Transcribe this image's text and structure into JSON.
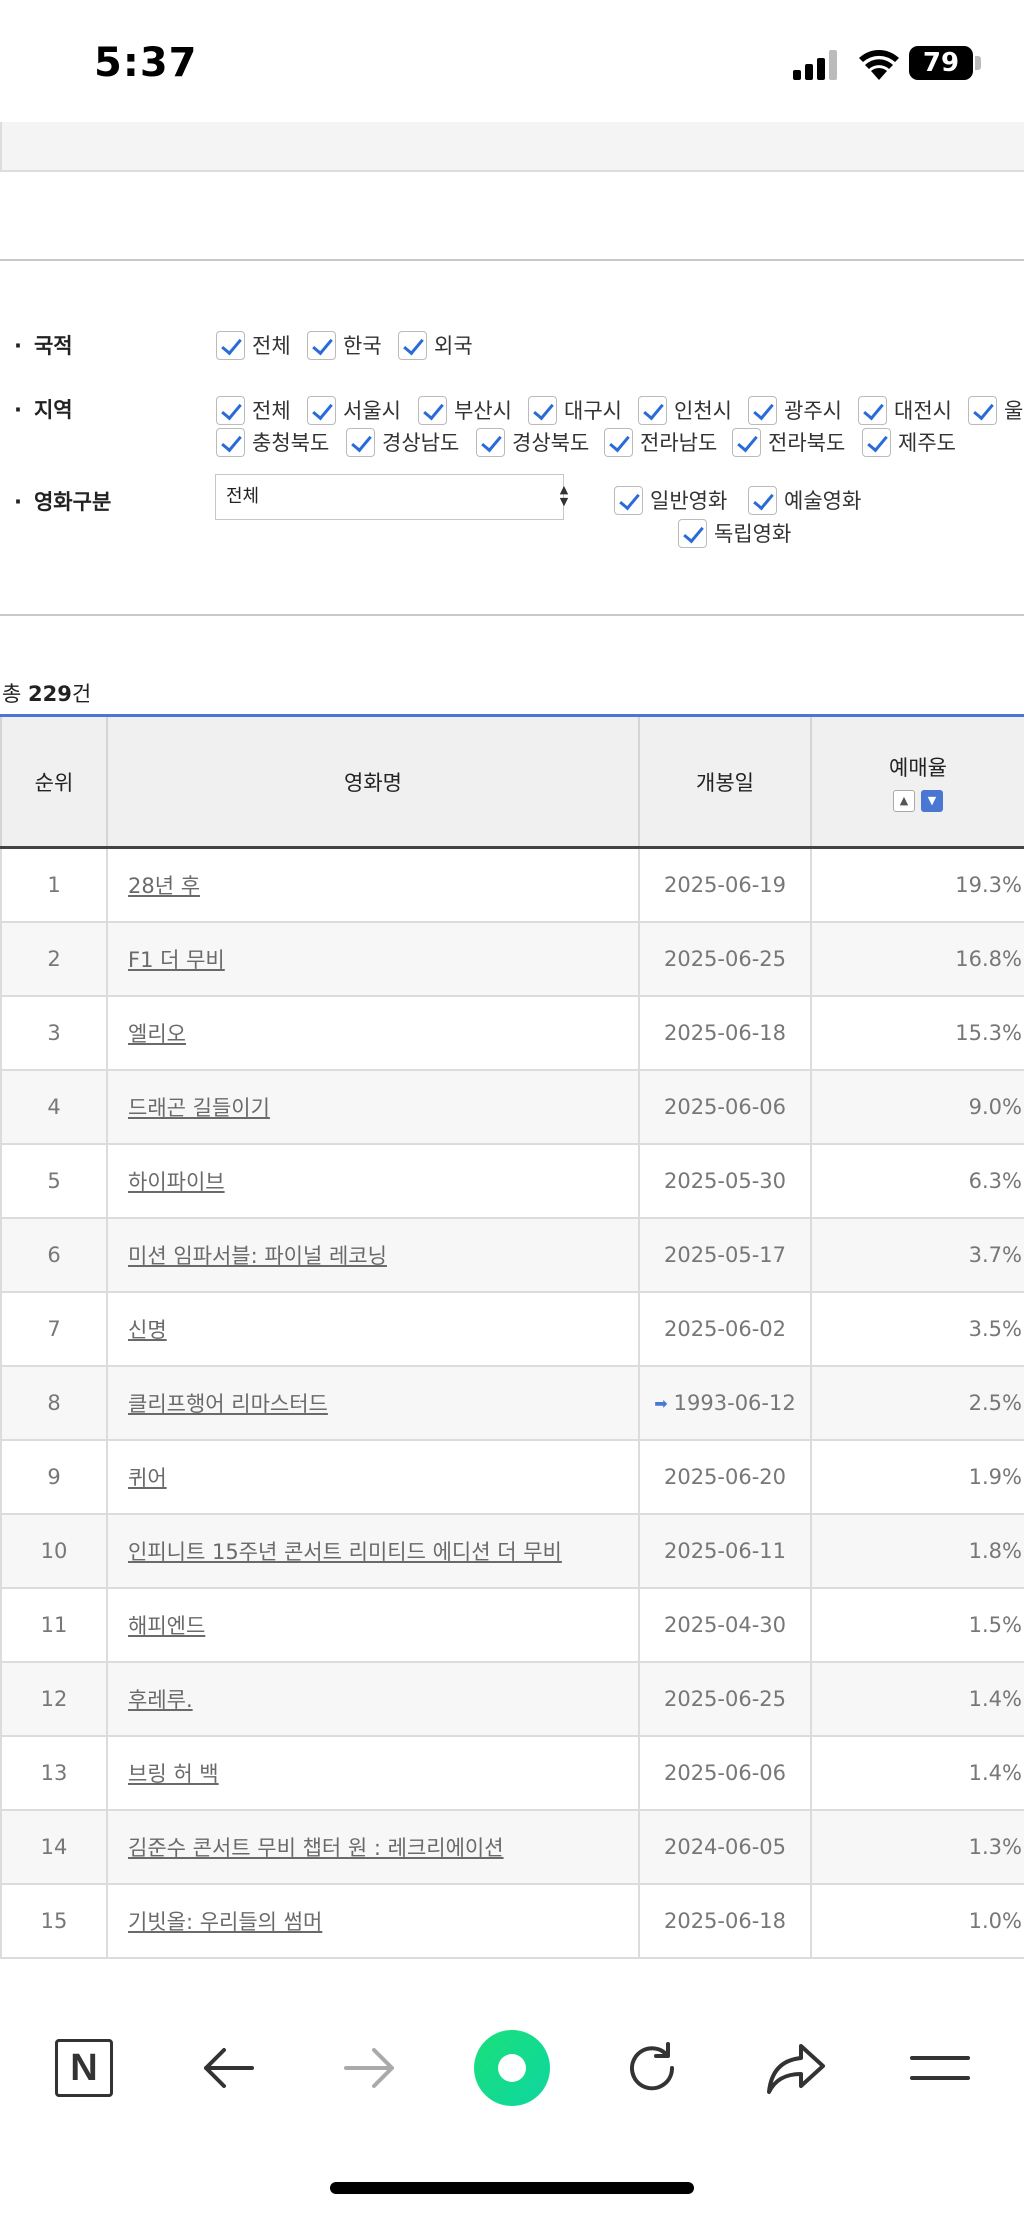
{
  "status": {
    "time": "5:37",
    "battery": "79"
  },
  "filters": {
    "nationality": {
      "label": "국적",
      "options": [
        "전체",
        "한국",
        "외국"
      ]
    },
    "region": {
      "label": "지역",
      "row1": [
        "전체",
        "서울시",
        "부산시",
        "대구시",
        "인천시",
        "광주시",
        "대전시",
        "울"
      ],
      "row2": [
        "충청북도",
        "경상남도",
        "경상북도",
        "전라남도",
        "전라북도",
        "제주도"
      ]
    },
    "movie_type": {
      "label": "영화구분",
      "select_value": "전체",
      "options": [
        "일반영화",
        "예술영화",
        "독립영화"
      ]
    }
  },
  "total": {
    "prefix": "총 ",
    "count": "229",
    "suffix": "건"
  },
  "table": {
    "headers": {
      "rank": "순위",
      "title": "영화명",
      "date": "개봉일",
      "rate": "예매율"
    },
    "rows": [
      {
        "rank": "1",
        "title": "28년 후",
        "date": "2025-06-19",
        "rate": "19.3%"
      },
      {
        "rank": "2",
        "title": "F1 더 무비",
        "date": "2025-06-25",
        "rate": "16.8%"
      },
      {
        "rank": "3",
        "title": "엘리오",
        "date": "2025-06-18",
        "rate": "15.3%"
      },
      {
        "rank": "4",
        "title": "드래곤 길들이기",
        "date": "2025-06-06",
        "rate": "9.0%"
      },
      {
        "rank": "5",
        "title": "하이파이브",
        "date": "2025-05-30",
        "rate": "6.3%"
      },
      {
        "rank": "6",
        "title": "미션 임파서블: 파이널 레코닝",
        "date": "2025-05-17",
        "rate": "3.7%"
      },
      {
        "rank": "7",
        "title": "신명",
        "date": "2025-06-02",
        "rate": "3.5%"
      },
      {
        "rank": "8",
        "title": "클리프행어 리마스터드",
        "date": "1993-06-12",
        "rate": "2.5%",
        "rerelease": true
      },
      {
        "rank": "9",
        "title": "퀴어",
        "date": "2025-06-20",
        "rate": "1.9%"
      },
      {
        "rank": "10",
        "title": "인피니트 15주년 콘서트 리미티드 에디션 더 무비",
        "date": "2025-06-11",
        "rate": "1.8%"
      },
      {
        "rank": "11",
        "title": "해피엔드",
        "date": "2025-04-30",
        "rate": "1.5%"
      },
      {
        "rank": "12",
        "title": "후레루.",
        "date": "2025-06-25",
        "rate": "1.4%"
      },
      {
        "rank": "13",
        "title": "브링 허 백",
        "date": "2025-06-06",
        "rate": "1.4%"
      },
      {
        "rank": "14",
        "title": "김준수 콘서트 무비 챕터 원 : 레크리에이션",
        "date": "2024-06-05",
        "rate": "1.3%"
      },
      {
        "rank": "15",
        "title": "기빗올: 우리들의 썸머",
        "date": "2025-06-18",
        "rate": "1.0%"
      }
    ]
  },
  "toolbar": {
    "naver_label": "N"
  }
}
